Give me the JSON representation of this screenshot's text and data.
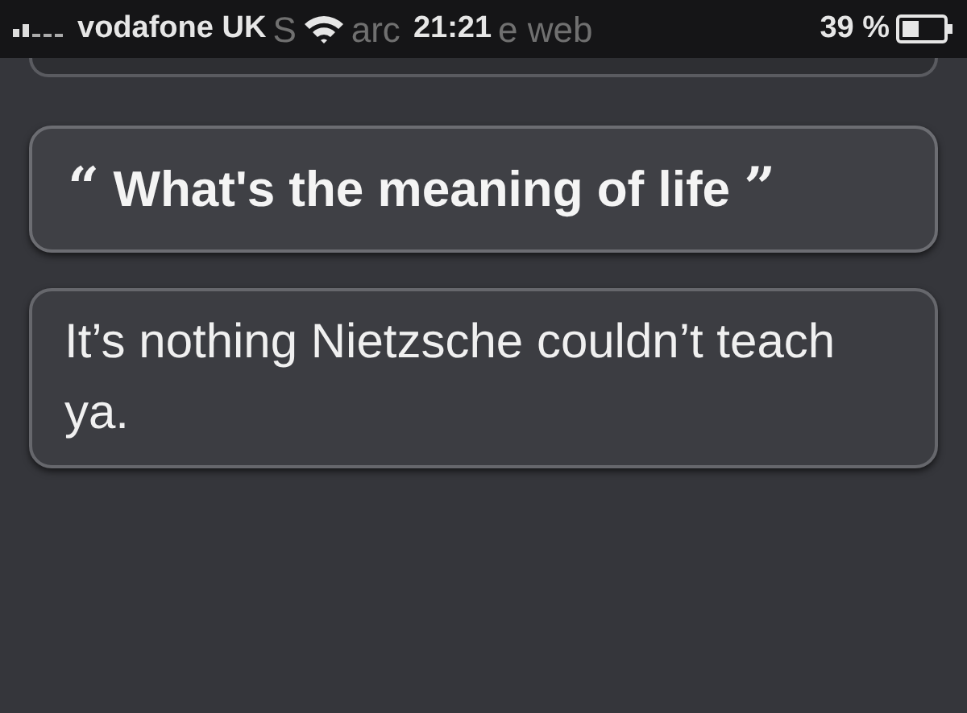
{
  "status_bar": {
    "carrier": "vodafone UK",
    "ghost_before": "S",
    "ghost_middle": "arc",
    "time": "21:21",
    "ghost_after": "e web",
    "battery_percent": "39 %"
  },
  "messages": [
    {
      "kind": "question",
      "open_quote": "“",
      "text": "What's the meaning of life",
      "close_quote": "”"
    },
    {
      "kind": "answer",
      "text": "It’s nothing Nietzsche couldn’t teach ya."
    }
  ]
}
